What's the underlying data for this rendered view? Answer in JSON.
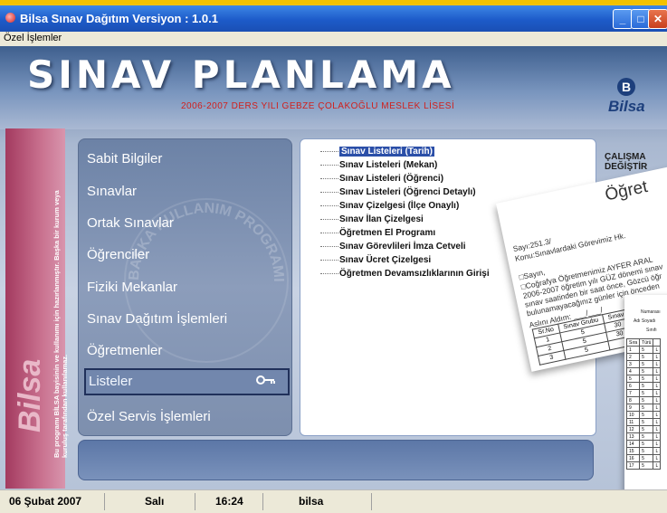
{
  "window": {
    "title": "Bilsa Sınav Dağıtım Versiyon : 1.0.1",
    "minimize": "_",
    "maximize": "□",
    "close": "✕"
  },
  "menubar": {
    "item": "Özel İşlemler"
  },
  "header": {
    "title": "SINAV PLANLAMA",
    "subtitle": "2006-2007 DERS YILI GEBZE ÇOLAKOĞLU MESLEK LİSESİ",
    "brand": "Bilsa",
    "brand_mark": "B"
  },
  "sidebar": {
    "brand": "Bilsa",
    "note": "Bu programı BİLSA bayisinin ve kullanımı için hazırlanmıştır. Başka bir kurum veya kuruluş tarafından kullanılamaz."
  },
  "watermark": "BAŞKA KULLANIM PROGRAMI",
  "nav": {
    "items": [
      "Sabit Bilgiler",
      "Sınavlar",
      "Ortak Sınavlar",
      "Öğrenciler",
      "Fiziki Mekanlar",
      "Sınav Dağıtım İşlemleri",
      "Öğretmenler",
      "Listeler",
      "Özel Servis İşlemleri"
    ]
  },
  "list": {
    "items": [
      "Sınav Listeleri (Tarih)",
      "Sınav Listeleri (Mekan)",
      "Sınav Listeleri (Öğrenci)",
      "Sınav Listeleri (Öğrenci Detaylı)",
      "Sınav Çizelgesi (İlçe Onaylı)",
      "Sınav İlan Çizelgesi",
      "Öğretmen El Programı",
      "Sınav Görevlileri İmza Cetveli",
      "Sınav Ücret Çizelgesi",
      "Öğretmen Devamsızlıklarının Girişi"
    ]
  },
  "right_label": {
    "line1": "ÇALIŞMA",
    "line2": "DEĞİŞTİR"
  },
  "paper": {
    "heading": "Öğret",
    "lines": [
      "Sayı:251.3/",
      "Konu:Sınavlardaki Görevimiz Hk.",
      "□Sayın,",
      "□Coğrafya Öğretmenimiz AYFER ARAL",
      "2006-2007 öğretim yılı GÜZ dönemi sınav",
      "sınav saatinden bir saat önce, Gözcü öğr",
      "bulunamayacağınız günler için önceden",
      "Aslını Aldım: ___/___/"
    ],
    "table_head": [
      "Sr.No",
      "Sınav Grubu",
      "Sınav"
    ],
    "table_rows": [
      [
        "1",
        "5",
        "30"
      ],
      [
        "2",
        "5",
        "30"
      ],
      [
        "3",
        "5",
        ""
      ]
    ]
  },
  "form": {
    "head1": "Numarası",
    "head2": "Adı Soyadı",
    "head3": "Sınıfı",
    "cols": [
      "Sıra",
      "Türü"
    ],
    "rows": [
      "1",
      "2",
      "3",
      "4",
      "5",
      "6",
      "7",
      "8",
      "9",
      "10",
      "11",
      "12",
      "13",
      "14",
      "15",
      "16",
      "17"
    ]
  },
  "statusbar": {
    "date": "06 Şubat 2007",
    "day": "Salı",
    "time": "16:24",
    "user": "bilsa"
  }
}
